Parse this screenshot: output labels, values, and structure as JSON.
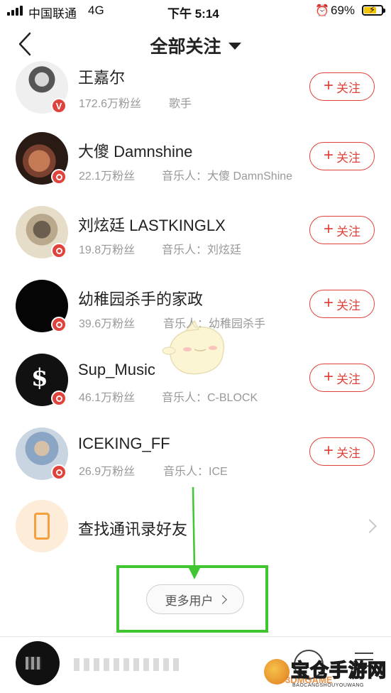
{
  "status_bar": {
    "carrier": "中国联通",
    "network": "4G",
    "time": "下午 5:14",
    "battery": "69%",
    "battery_level": 0.69
  },
  "nav": {
    "title": "全部关注",
    "back_icon": "chevron-left-icon",
    "dropdown_icon": "caret-down-icon"
  },
  "users": [
    {
      "name": "王嘉尔",
      "fans": "172.6万粉丝",
      "desc": "歌手",
      "badge": "V",
      "follow_label": "关注"
    },
    {
      "name": "大傻 Damnshine",
      "fans": "22.1万粉丝",
      "desc": "音乐人：大傻 DamnShine",
      "badge": "musician",
      "follow_label": "关注"
    },
    {
      "name": "刘炫廷 LASTKINGLX",
      "fans": "19.8万粉丝",
      "desc": "音乐人：刘炫廷",
      "badge": "musician",
      "follow_label": "关注"
    },
    {
      "name": "幼稚园杀手的家政",
      "fans": "39.6万粉丝",
      "desc": "音乐人：幼稚园杀手",
      "badge": "musician",
      "follow_label": "关注"
    },
    {
      "name": "Sup_Music",
      "fans": "46.1万粉丝",
      "desc": "音乐人：C-BLOCK",
      "badge": "musician",
      "follow_label": "关注"
    },
    {
      "name": "ICEKING_FF",
      "fans": "26.9万粉丝",
      "desc": "音乐人：ICE",
      "badge": "musician",
      "follow_label": "关注"
    }
  ],
  "contacts": {
    "label": "查找通讯录好友",
    "icon": "phone-icon"
  },
  "more_users": {
    "label": "更多用户"
  },
  "watermark": {
    "brand": "宝仓手游网",
    "brand_en": "3DMGAME",
    "sub": "BAOCANGSHOUYOUWANG"
  },
  "colors": {
    "accent": "#e0433c",
    "annotation": "#3fc630",
    "contacts_bg": "#fdecd8",
    "contacts_icon": "#f5a03c"
  }
}
